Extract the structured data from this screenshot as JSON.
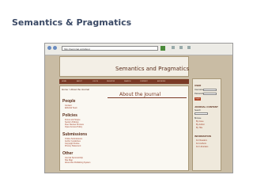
{
  "slide": {
    "title": "Semantics & Pragmatics"
  },
  "browser": {
    "address": "http://semprag.org/about"
  },
  "site": {
    "title": "Semantics and Pragmatics",
    "nav": [
      "HOME",
      "ABOUT",
      "LOG IN",
      "REGISTER",
      "SEARCH",
      "CURRENT",
      "ARCHIVES"
    ],
    "breadcrumb": "Home > About the Journal",
    "heading": "About the Journal",
    "sections": [
      {
        "title": "People",
        "links": [
          "Contact",
          "Editorial Team"
        ]
      },
      {
        "title": "Policies",
        "links": [
          "Focus and Scope",
          "Section Policies",
          "Peer Review Process",
          "Open Access Policy"
        ]
      },
      {
        "title": "Submissions",
        "links": [
          "Online Submissions",
          "Author Guidelines",
          "Copyright Notice",
          "Privacy Statement"
        ]
      },
      {
        "title": "Other",
        "links": [
          "Journal Sponsorship",
          "Site Map",
          "About this Publishing System"
        ]
      }
    ]
  },
  "sidebar": {
    "user_heading": "USER",
    "username_label": "Username",
    "password_label": "Password",
    "login_label": "Log In",
    "journal_heading": "JOURNAL CONTENT",
    "search_label": "Search",
    "browse_heading": "Browse",
    "browse_links": [
      "By Issue",
      "By Author",
      "By Title"
    ],
    "info_heading": "INFORMATION",
    "info_links": [
      "For Readers",
      "For Authors",
      "For Librarians"
    ]
  }
}
